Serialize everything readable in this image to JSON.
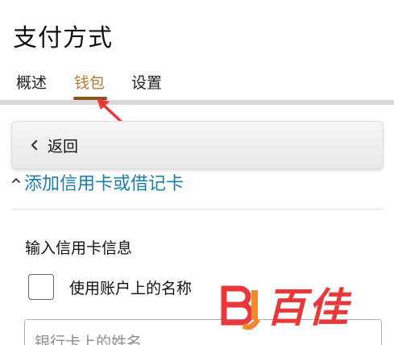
{
  "page": {
    "title": "支付方式"
  },
  "tabs": [
    {
      "label": "概述",
      "active": false
    },
    {
      "label": "钱包",
      "active": true
    },
    {
      "label": "设置",
      "active": false
    }
  ],
  "back": {
    "label": "返回",
    "icon": "chevron-left-icon"
  },
  "add_card": {
    "label": "添加信用卡或借记卡",
    "icon": "caret-up-icon"
  },
  "form": {
    "heading": "输入信用卡信息",
    "use_account_name": {
      "label": "使用账户上的名称",
      "checked": false
    },
    "cardholder_name": {
      "placeholder": "银行卡上的姓名",
      "value": ""
    }
  },
  "watermark": {
    "logo_letters": "BJ",
    "text": "百佳"
  },
  "colors": {
    "active_tab": "#b7792f",
    "tab_underline": "#8a5420",
    "link": "#1a7fa8",
    "annotation_arrow": "#e8383a",
    "watermark": "#e8383a"
  }
}
